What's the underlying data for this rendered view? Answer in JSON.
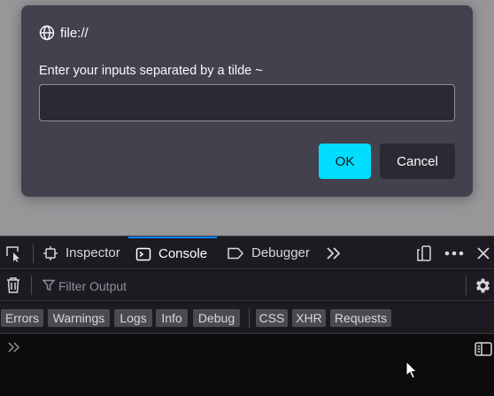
{
  "page": {
    "background": "#97979a"
  },
  "dialog": {
    "title": "file://",
    "message": "Enter your inputs separated by a tilde ~",
    "input_value": "",
    "ok_label": "OK",
    "cancel_label": "Cancel",
    "accent": "#00ddff"
  },
  "devtools": {
    "tabs": [
      {
        "label": "Inspector",
        "icon": "inspector-icon",
        "selected": false
      },
      {
        "label": "Console",
        "icon": "console-icon",
        "selected": true
      },
      {
        "label": "Debugger",
        "icon": "debugger-icon",
        "selected": false
      }
    ],
    "filter_placeholder": "Filter Output",
    "log_levels": [
      "Errors",
      "Warnings",
      "Logs",
      "Info",
      "Debug"
    ],
    "request_types": [
      "CSS",
      "XHR",
      "Requests"
    ],
    "selected_tab_color": "#0a84ff"
  }
}
